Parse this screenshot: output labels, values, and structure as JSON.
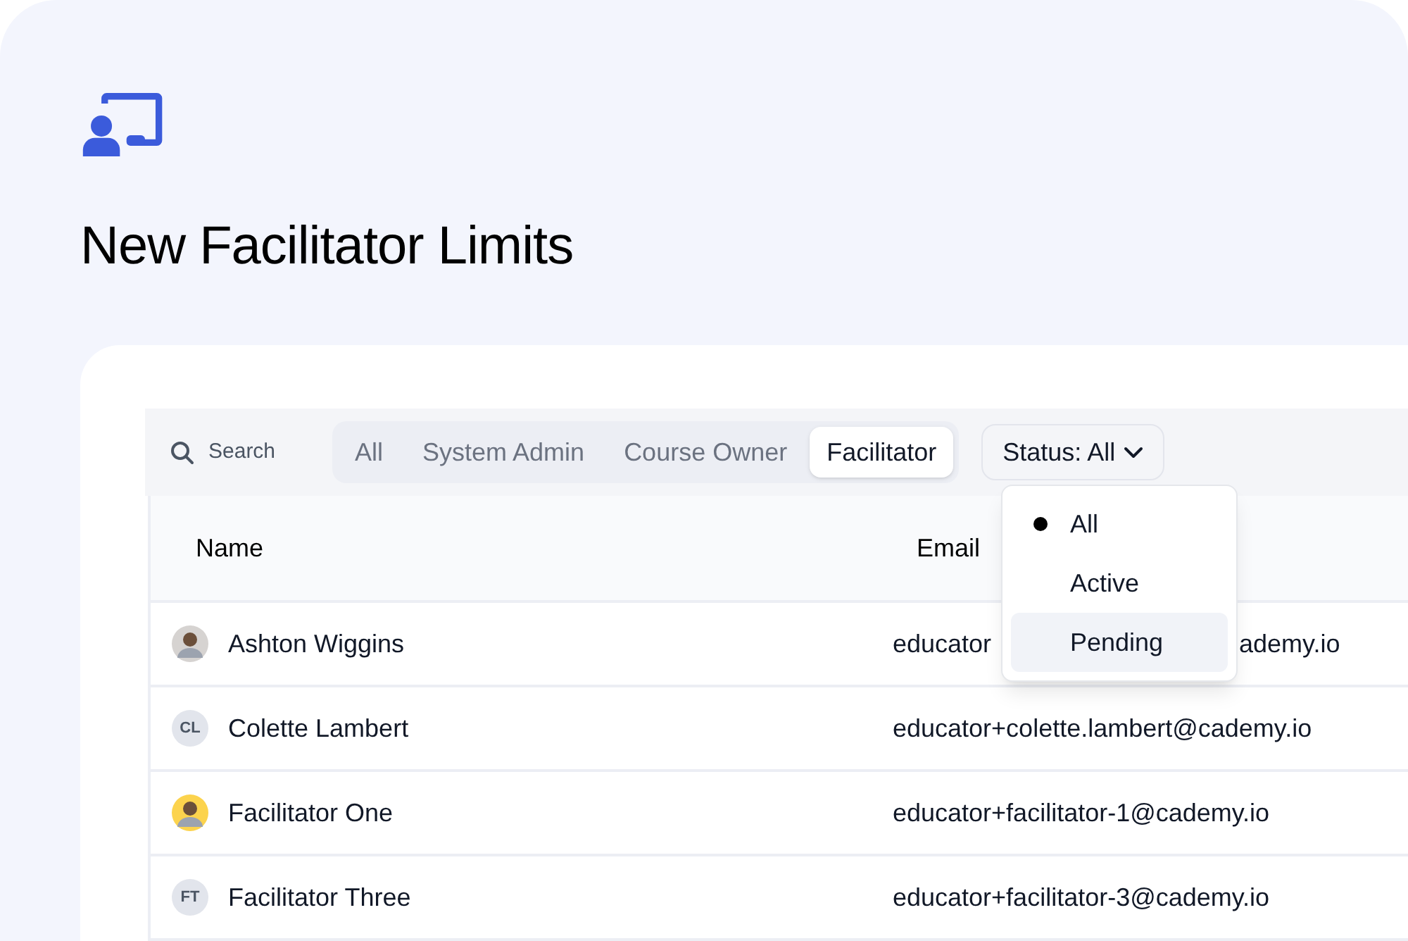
{
  "page": {
    "title": "New Facilitator Limits"
  },
  "toolbar": {
    "search_placeholder": "Search",
    "tabs": [
      {
        "label": "All",
        "selected": false
      },
      {
        "label": "System Admin",
        "selected": false
      },
      {
        "label": "Course Owner",
        "selected": false
      },
      {
        "label": "Facilitator",
        "selected": true
      }
    ],
    "status_filter": {
      "label": "Status: All",
      "expanded": true,
      "options": [
        {
          "label": "All",
          "selected": true,
          "highlighted": false
        },
        {
          "label": "Active",
          "selected": false,
          "highlighted": false
        },
        {
          "label": "Pending",
          "selected": false,
          "highlighted": true
        }
      ]
    }
  },
  "table": {
    "columns": [
      "Name",
      "Email"
    ],
    "rows": [
      {
        "avatar": {
          "kind": "photo",
          "color": "#d6d3d1"
        },
        "name": "Ashton Wiggins",
        "email_start": "educator",
        "email_end": "ademy.io"
      },
      {
        "avatar": {
          "kind": "initials",
          "initials": "CL"
        },
        "name": "Colette Lambert",
        "email": "educator+colette.lambert@cademy.io"
      },
      {
        "avatar": {
          "kind": "photo",
          "color": "#fcd34d"
        },
        "name": "Facilitator One",
        "email": "educator+facilitator-1@cademy.io"
      },
      {
        "avatar": {
          "kind": "initials",
          "initials": "FT"
        },
        "name": "Facilitator Three",
        "email": "educator+facilitator-3@cademy.io"
      }
    ]
  }
}
